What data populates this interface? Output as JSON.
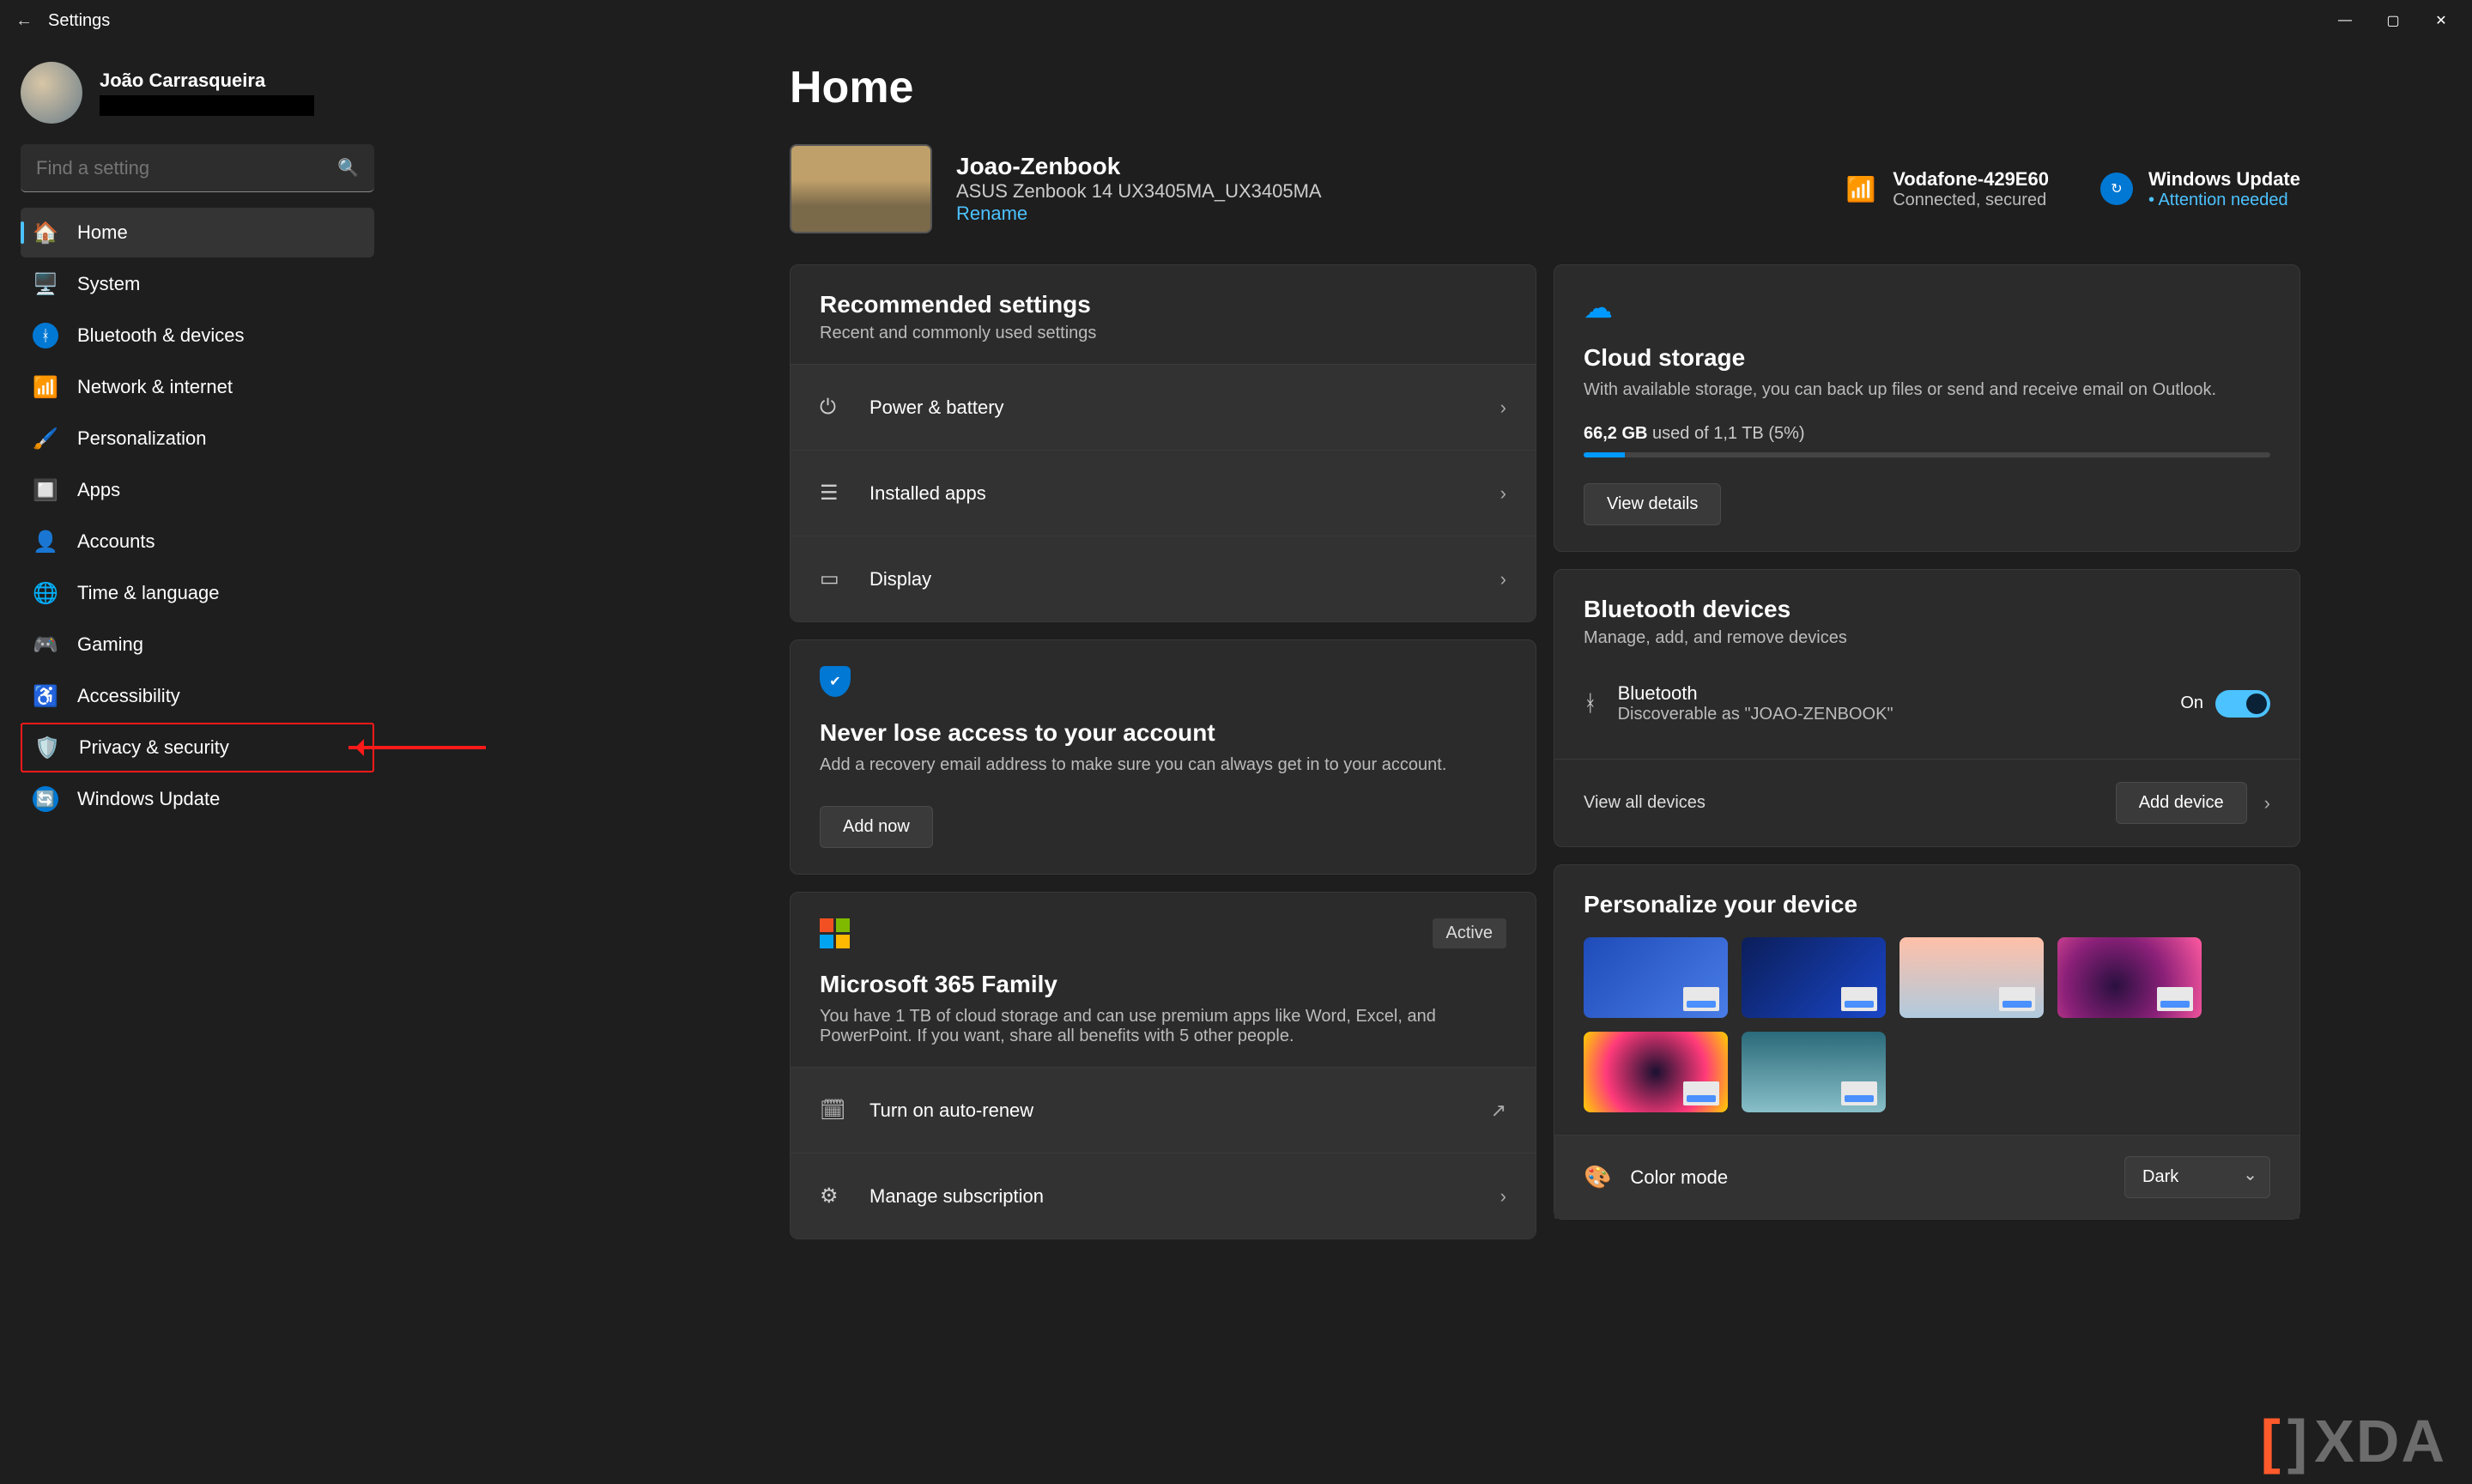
{
  "window": {
    "title": "Settings"
  },
  "profile": {
    "name": "João Carrasqueira"
  },
  "search": {
    "placeholder": "Find a setting"
  },
  "sidebar": {
    "items": [
      {
        "label": "Home",
        "icon": "🏠"
      },
      {
        "label": "System",
        "icon": "🖥️"
      },
      {
        "label": "Bluetooth & devices",
        "icon": "ᚼ"
      },
      {
        "label": "Network & internet",
        "icon": "📶"
      },
      {
        "label": "Personalization",
        "icon": "🖌️"
      },
      {
        "label": "Apps",
        "icon": "🔲"
      },
      {
        "label": "Accounts",
        "icon": "👤"
      },
      {
        "label": "Time & language",
        "icon": "🌐"
      },
      {
        "label": "Gaming",
        "icon": "🎮"
      },
      {
        "label": "Accessibility",
        "icon": "♿"
      },
      {
        "label": "Privacy & security",
        "icon": "🛡️"
      },
      {
        "label": "Windows Update",
        "icon": "🔄"
      }
    ]
  },
  "page": {
    "title": "Home"
  },
  "device": {
    "name": "Joao-Zenbook",
    "model": "ASUS Zenbook 14 UX3405MA_UX3405MA",
    "rename": "Rename"
  },
  "status": {
    "wifi": {
      "title": "Vodafone-429E60",
      "sub": "Connected, secured"
    },
    "update": {
      "title": "Windows Update",
      "sub": "Attention needed"
    }
  },
  "recommended": {
    "title": "Recommended settings",
    "sub": "Recent and commonly used settings",
    "items": [
      {
        "label": "Power & battery",
        "icon": "⏻"
      },
      {
        "label": "Installed apps",
        "icon": "☰"
      },
      {
        "label": "Display",
        "icon": "▭"
      }
    ]
  },
  "account_recovery": {
    "title": "Never lose access to your account",
    "body": "Add a recovery email address to make sure you can always get in to your account.",
    "button": "Add now"
  },
  "m365": {
    "badge": "Active",
    "title": "Microsoft 365 Family",
    "body": "You have 1 TB of cloud storage and can use premium apps like Word, Excel, and PowerPoint. If you want, share all benefits with 5 other people.",
    "row1": "Turn on auto-renew",
    "row2": "Manage subscription"
  },
  "cloud": {
    "title": "Cloud storage",
    "body": "With available storage, you can back up files or send and receive email on Outlook.",
    "used_bold": "66,2 GB",
    "used_rest": " used of 1,1 TB (5%)",
    "button": "View details",
    "percent": 6
  },
  "bluetooth": {
    "title": "Bluetooth devices",
    "sub": "Manage, add, and remove devices",
    "toggle_label": "On",
    "bt_label": "Bluetooth",
    "bt_sub": "Discoverable as \"JOAO-ZENBOOK\"",
    "view_all": "View all devices",
    "add": "Add device"
  },
  "personalize": {
    "title": "Personalize your device",
    "colormode_label": "Color mode",
    "colormode_value": "Dark",
    "themes": [
      {
        "bg": "linear-gradient(135deg,#1e4bb8,#4a7de8)",
        "accent": "#4a90ff"
      },
      {
        "bg": "linear-gradient(135deg,#0b1e5a,#1a46c8)",
        "accent": "#1a46c8"
      },
      {
        "bg": "linear-gradient(#ffc0a8,#b0cade)",
        "accent": "#4a90ff"
      },
      {
        "bg": "radial-gradient(circle at 40% 60%,#2a1040,#8a2078,#ff5aa0)",
        "accent": "#bb2288"
      },
      {
        "bg": "radial-gradient(circle at 50% 50%,#1a1030,#ff3a7a 60%,#ffd000)",
        "accent": "#ff0000"
      },
      {
        "bg": "linear-gradient(#2a6a7a,#88bfc8)",
        "accent": "#4a90ff"
      }
    ]
  },
  "watermark": "XDA"
}
